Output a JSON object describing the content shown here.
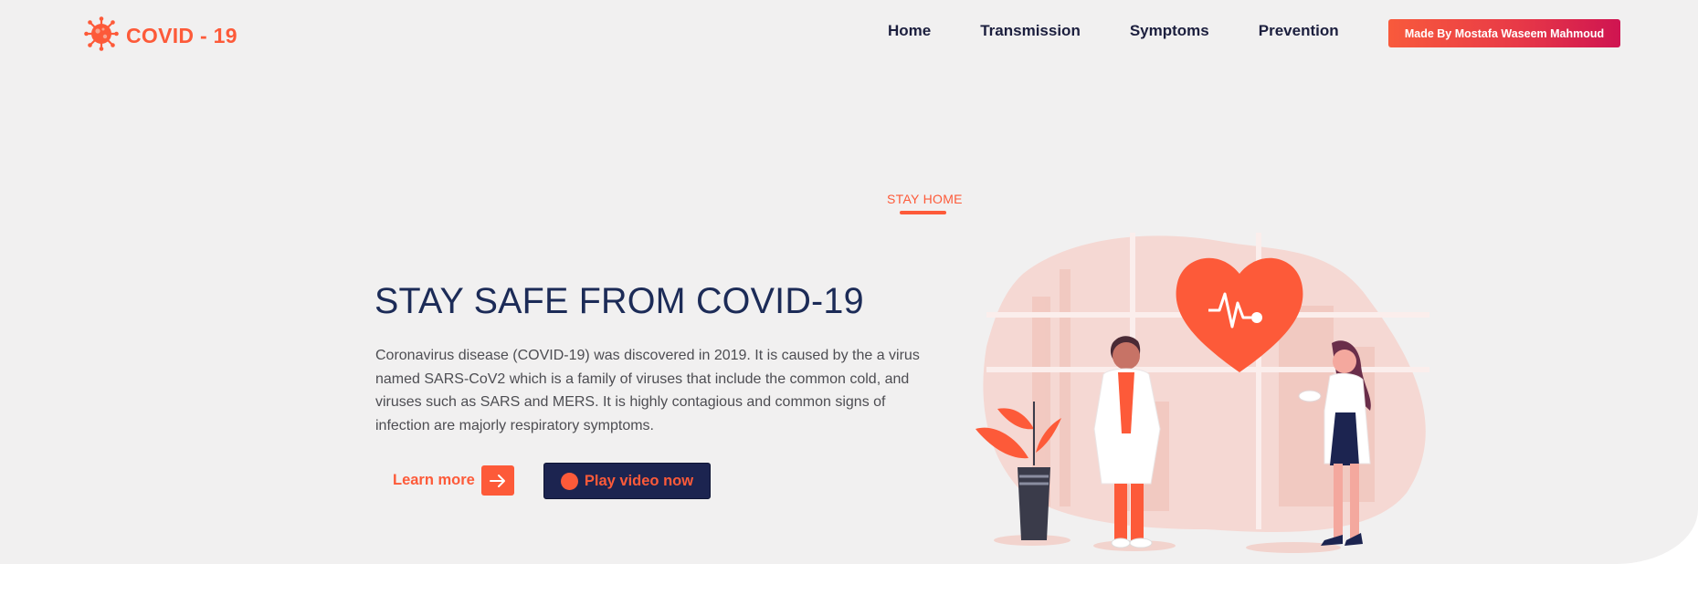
{
  "logo": {
    "title": "COVID - 19",
    "icon": "virus-icon"
  },
  "nav": {
    "items": [
      "Home",
      "Transmission",
      "Symptoms",
      "Prevention"
    ]
  },
  "cta": {
    "made_by_label": "Made By Mostafa Waseem Mahmoud"
  },
  "hero": {
    "kicker": "STAY HOME",
    "title": "STAY SAFE FROM COVID-19",
    "description": "Coronavirus disease (COVID-19) was discovered in 2019. It is caused by the a virus named SARS-CoV2 which is a family of viruses that include the common cold, and viruses such as SARS and MERS. It is highly contagious and common signs of infection are majorly respiratory symptoms.",
    "learn_more_label": "Learn more",
    "learn_more_icon": "arrow-right-icon",
    "play_label": "Play video now",
    "play_icon": "play-dot-icon"
  },
  "colors": {
    "accent": "#fd5a39",
    "navy": "#1c2450",
    "background": "#f1f0f0",
    "gradient_end": "#cf1451"
  }
}
